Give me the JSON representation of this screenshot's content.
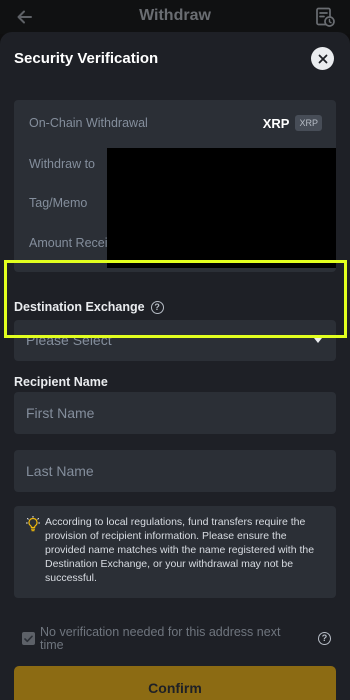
{
  "app_header": {
    "title": "Withdraw",
    "back_icon": "arrow-left-icon",
    "history_icon": "history-doc-icon"
  },
  "sheet": {
    "title": "Security Verification",
    "close_icon": "close-icon"
  },
  "summary": {
    "rows": [
      "On-Chain Withdrawal",
      "Withdraw to",
      "Tag/Memo",
      "Amount Recei"
    ],
    "coin": "XRP",
    "coin_tag": "XRP"
  },
  "destination": {
    "label": "Destination Exchange",
    "placeholder": "Please Select",
    "highlight_color": "#e2ff1f"
  },
  "recipient": {
    "label": "Recipient Name",
    "first_name_placeholder": "First Name",
    "last_name_placeholder": "Last Name"
  },
  "notice": {
    "icon": "lightbulb-icon",
    "text": "According to local regulations, fund transfers require the provision of recipient information. Please ensure the provided name matches with the name registered with the Destination Exchange, or your withdrawal may not be successful."
  },
  "verification": {
    "checked": true,
    "text": "No verification needed for this address next time"
  },
  "actions": {
    "confirm_label": "Confirm",
    "confirm_color": "#8c6b13"
  }
}
